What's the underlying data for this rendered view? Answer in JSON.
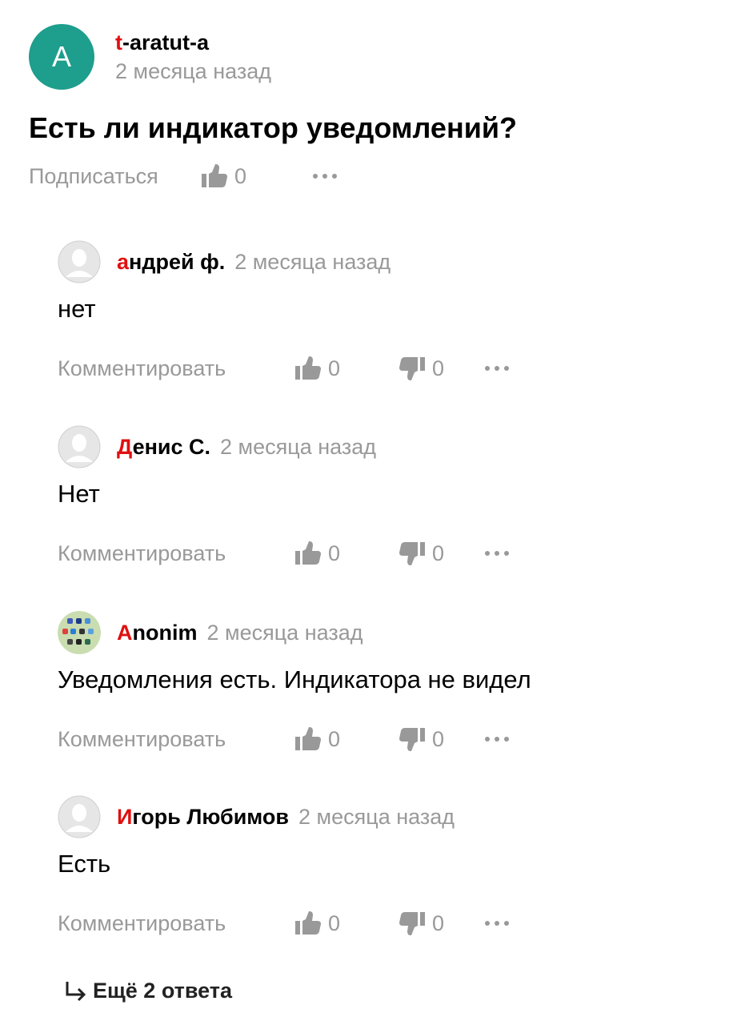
{
  "question": {
    "avatar_letter": "A",
    "avatar_color": "#1e9e8c",
    "author_first": "t",
    "author_rest": "-aratut-a",
    "time": "2 месяца назад",
    "title": "Есть ли индикатор уведомлений?",
    "subscribe_label": "Подписаться",
    "likes": "0",
    "like_icon": "thumbs-up-icon",
    "more_icon": "more-dots-icon"
  },
  "comment_action_label": "Комментировать",
  "comments": [
    {
      "author_first": "а",
      "author_rest": "ндрей ф.",
      "time": "2 месяца назад",
      "text": "нет",
      "likes": "0",
      "dislikes": "0",
      "avatar": "default-user-avatar"
    },
    {
      "author_first": "Д",
      "author_rest": "енис С.",
      "time": "2 месяца назад",
      "text": "Нет",
      "likes": "0",
      "dislikes": "0",
      "avatar": "default-user-avatar"
    },
    {
      "author_first": "А",
      "author_rest": "nonim",
      "time": "2 месяца назад",
      "text": "Уведомления есть. Индикатора не видел",
      "likes": "0",
      "dislikes": "0",
      "avatar": "app-icons-avatar"
    },
    {
      "author_first": "И",
      "author_rest": "горь Любимов",
      "time": "2 месяца назад",
      "text": "Есть",
      "likes": "0",
      "dislikes": "0",
      "avatar": "default-user-avatar"
    }
  ],
  "more_answers_label": "Ещё 2 ответа",
  "colors": {
    "accent_letter": "#e01010",
    "muted_text": "#999999",
    "avatar_bg": "#1e9e8c"
  }
}
